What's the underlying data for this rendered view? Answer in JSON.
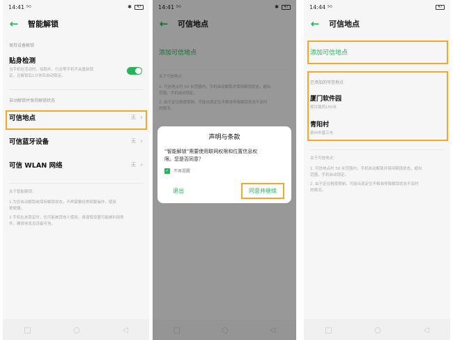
{
  "screen1": {
    "time": "14:41",
    "signal": "⁵ᴳ",
    "battery": "47",
    "title": "智能解锁",
    "sect_keep": "保持设备解锁",
    "body_detect_title": "贴身检测",
    "body_detect_desc_1": "当手机在活动时，如跑步、行走等手机不会重新锁",
    "body_detect_desc_2": "定，且解锁后1分钟后自动锁定。",
    "sect_auto": "自动解锁并保持解锁状态",
    "trusted_places": "可信地点",
    "trusted_places_value": "无",
    "trusted_bt": "可信蓝牙设备",
    "trusted_bt_value": "无",
    "trusted_wlan": "可信 WLAN 网络",
    "trusted_wlan_value": "无",
    "about_title": "关于智能解锁：",
    "about_1a": "1.为您自动解锁或保持解锁状态，不再需要经常频繁操作，使用",
    "about_1b": "更便捷。",
    "about_2a": "2.手机在未锁定时，也可能被其他人使用，请谨慎设置可能被利用条",
    "about_2b": "件，确保信息及设备可信。"
  },
  "screen2": {
    "time": "14:41",
    "signal": "⁵ᴳ",
    "battery": "47",
    "title": "可信地点",
    "add_place": "添加可信地点",
    "about_title": "关于可信地点：",
    "about_1a": "1. 可信地点约 50 米范围内，手机自动解锁并保持解锁状态，超出",
    "about_1b": "范围，手机自动锁定。",
    "about_2a": "2. 由于定位精度限制，可能出现定位不精准导致解锁状态不及时",
    "about_2b": "的情况。",
    "dialog_title": "声明与条款",
    "dialog_text_1": "“智能解锁”需要使用联网权限和位置信息权",
    "dialog_text_2": "限。您是否同意？",
    "dialog_check": "不再提醒",
    "dialog_exit": "退出",
    "dialog_agree": "同意并继续"
  },
  "screen3": {
    "time": "14:44",
    "signal": "⁵ᴳ",
    "battery": "47",
    "title": "可信地点",
    "add_place": "添加可信地点",
    "added_label": "已添加的可信地点",
    "loc1_name": "厦门软件园",
    "loc1_sub": "观日路西150米",
    "loc2_name": "青阳村",
    "loc2_sub": "泉州市晋江市",
    "about_title": "关于可信地点：",
    "about_1a": "1. 可信地点约 50 米范围内，手机自动解锁并保持解锁状态，超出",
    "about_1b": "范围，手机自动锁定。",
    "about_2a": "2. 由于定位精度限制，可能出现定位不精准导致解锁状态不及时",
    "about_2b": "的情况。"
  },
  "icons": {
    "back": "←",
    "chevron": "›",
    "bluetooth": "✱",
    "nav_square": "□",
    "nav_circle": "○",
    "nav_back": "◁"
  },
  "colors": {
    "accent": "#26b35a",
    "highlight": "#f5a623"
  }
}
